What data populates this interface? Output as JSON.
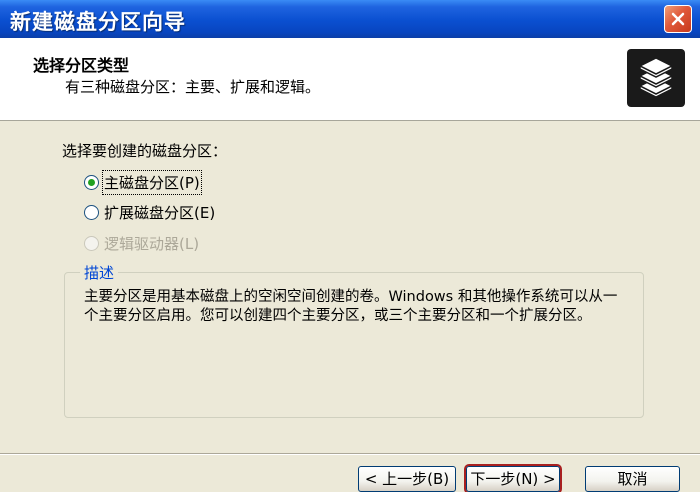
{
  "window": {
    "title": "新建磁盘分区向导"
  },
  "header": {
    "title": "选择分区类型",
    "subtitle": "有三种磁盘分区：主要、扩展和逻辑。",
    "icon": "stacked-disks-icon"
  },
  "partition_group": {
    "label": "选择要创建的磁盘分区：",
    "options": [
      {
        "label": "主磁盘分区(P)",
        "checked": true,
        "enabled": true
      },
      {
        "label": "扩展磁盘分区(E)",
        "checked": false,
        "enabled": true
      },
      {
        "label": "逻辑驱动器(L)",
        "checked": false,
        "enabled": false
      }
    ]
  },
  "description": {
    "legend": "描述",
    "text": "主要分区是用基本磁盘上的空闲空间创建的卷。Windows 和其他操作系统可以从一个主要分区启用。您可以创建四个主要分区，或三个主要分区和一个扩展分区。"
  },
  "buttons": {
    "back": "< 上一步(B)",
    "next": "下一步(N) >",
    "cancel": "取消"
  },
  "colors": {
    "titlebar": "#0a4fd0",
    "dialog_bg": "#ECE9D8",
    "legend_text": "#0046d5",
    "radio_checked": "#21a121",
    "highlight_border": "#a82020"
  }
}
